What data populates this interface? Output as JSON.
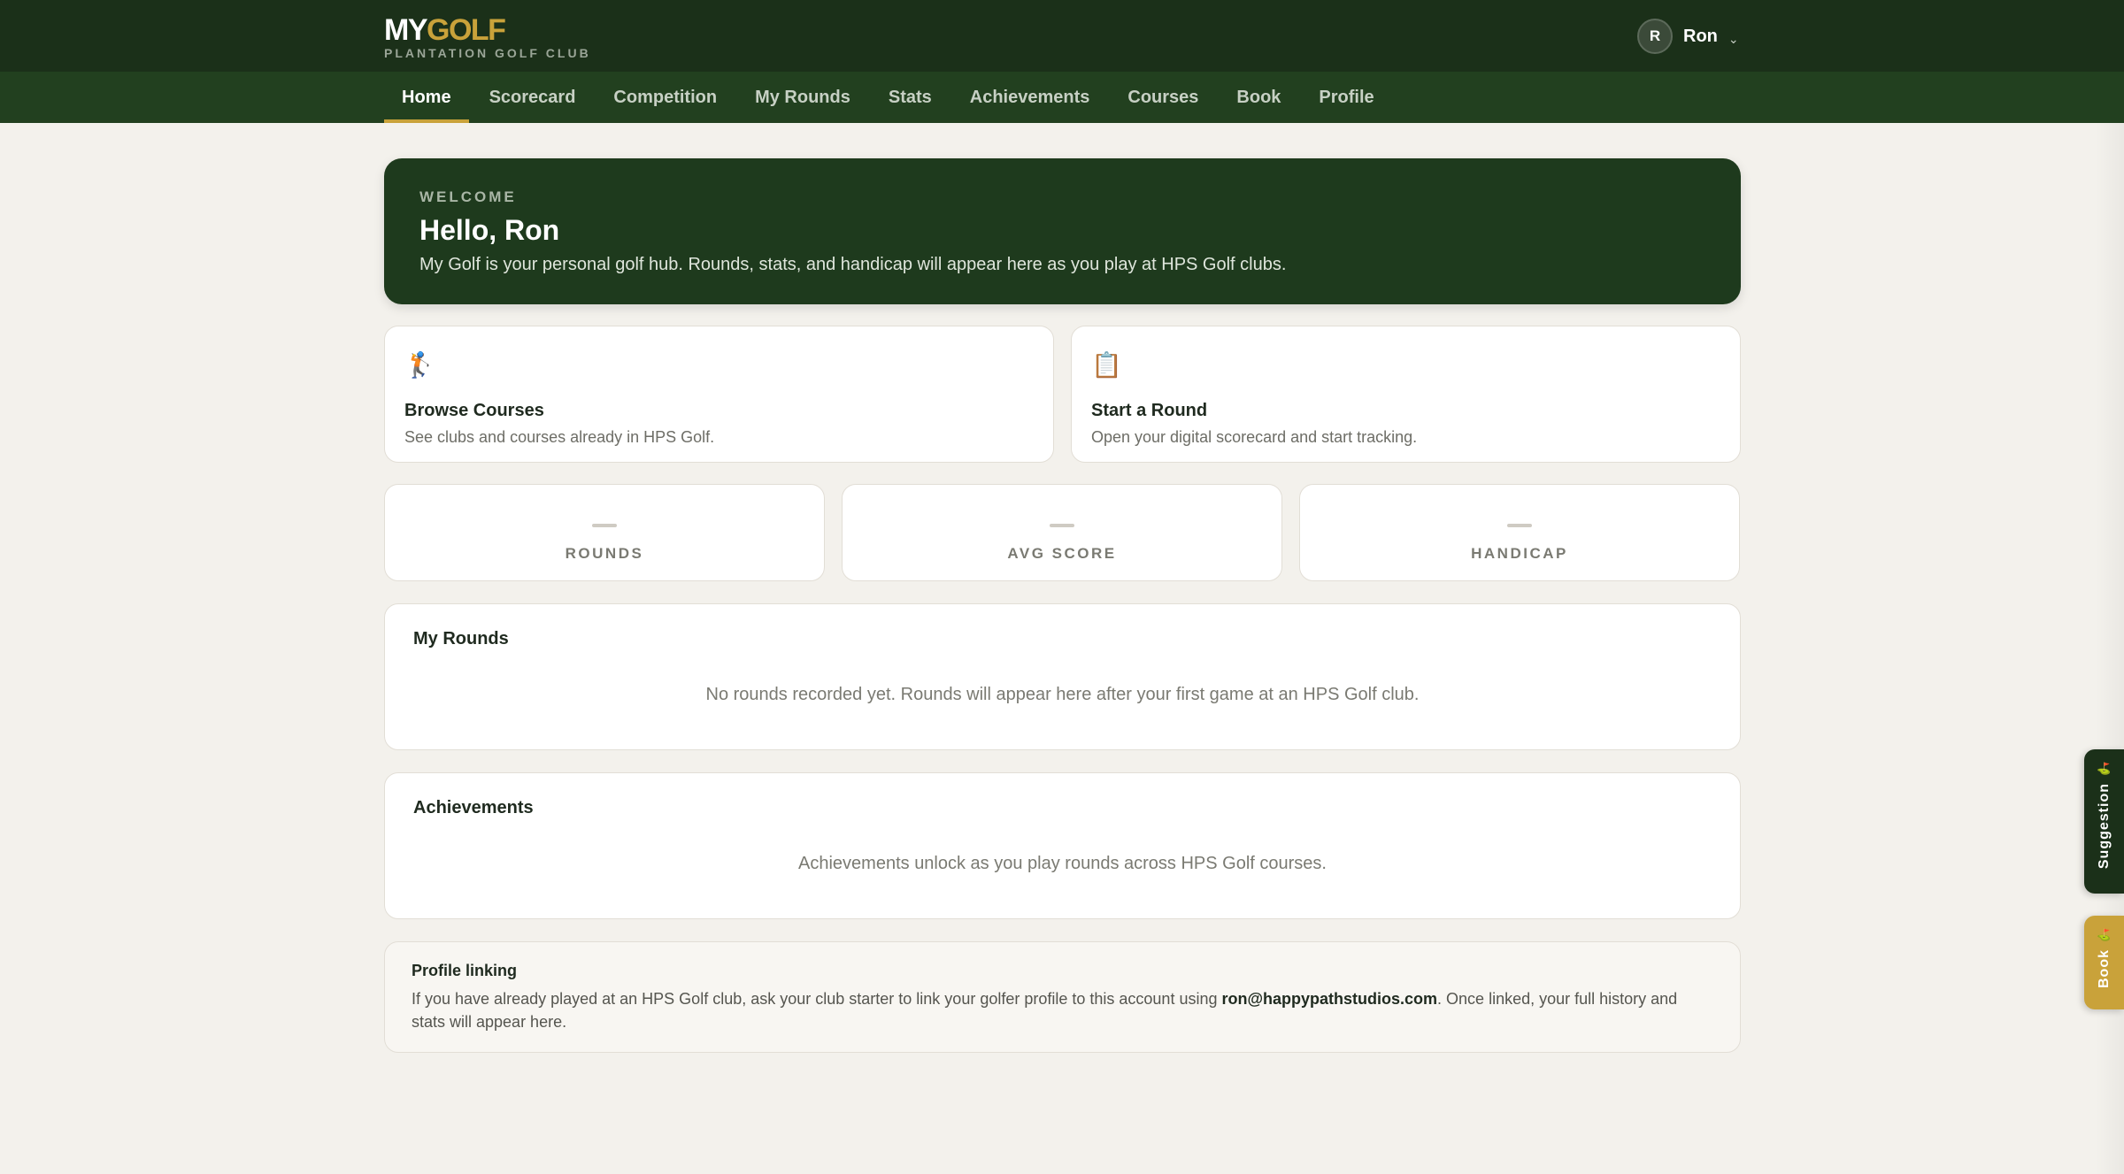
{
  "brand": {
    "logo_my": "MY",
    "logo_golf": "GOLF",
    "club": "PLANTATION GOLF CLUB"
  },
  "user": {
    "initial": "R",
    "name": "Ron",
    "caret": "⌄"
  },
  "nav": [
    {
      "label": "Home",
      "active": true
    },
    {
      "label": "Scorecard"
    },
    {
      "label": "Competition"
    },
    {
      "label": "My Rounds"
    },
    {
      "label": "Stats"
    },
    {
      "label": "Achievements"
    },
    {
      "label": "Courses"
    },
    {
      "label": "Book"
    },
    {
      "label": "Profile"
    }
  ],
  "welcome": {
    "kicker": "WELCOME",
    "title": "Hello, Ron",
    "text": "My Golf is your personal golf hub. Rounds, stats, and handicap will appear here as you play at HPS Golf clubs."
  },
  "actions": [
    {
      "icon": "🏌",
      "icon_name": "golfer-icon",
      "title": "Browse Courses",
      "text": "See clubs and courses already in HPS Golf."
    },
    {
      "icon": "📋",
      "icon_name": "clipboard-icon",
      "title": "Start a Round",
      "text": "Open your digital scorecard and start tracking."
    }
  ],
  "stats": [
    {
      "value": "—",
      "label": "ROUNDS"
    },
    {
      "value": "—",
      "label": "AVG SCORE"
    },
    {
      "value": "—",
      "label": "HANDICAP"
    }
  ],
  "my_rounds": {
    "title": "My Rounds",
    "empty": "No rounds recorded yet. Rounds will appear here after your first game at an HPS Golf club."
  },
  "achievements": {
    "title": "Achievements",
    "empty": "Achievements unlock as you play rounds across HPS Golf courses."
  },
  "profile_linking": {
    "title": "Profile linking",
    "text_before": "If you have already played at an HPS Golf club, ask your club starter to link your golfer profile to this account using ",
    "email": "ron@happypathstudios.com",
    "text_after": ". Once linked, your full history and stats will appear here."
  },
  "side_tabs": {
    "suggestion": "Suggestion",
    "book": "Book",
    "flag_icon": "golf-flag-icon"
  },
  "colors": {
    "header_bg": "#1b3019",
    "nav_bg": "#22401f",
    "accent_gold": "#c9a23a",
    "page_bg": "#f3f1ec"
  }
}
